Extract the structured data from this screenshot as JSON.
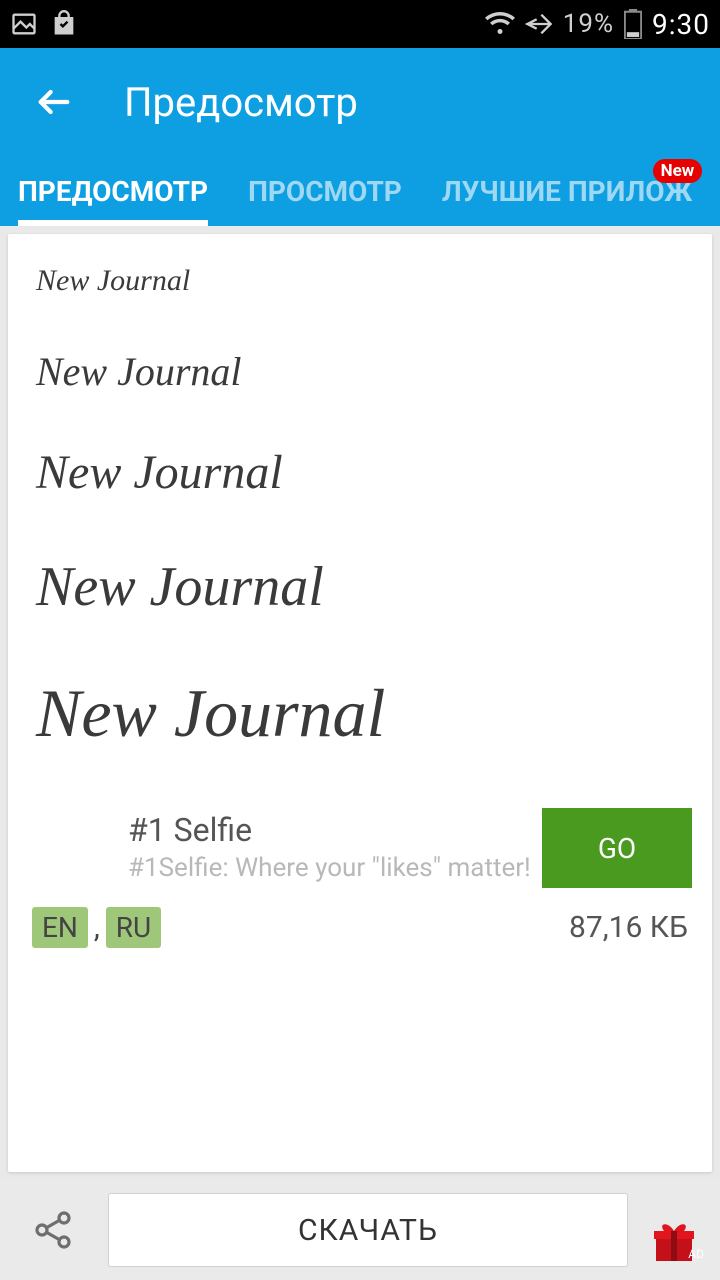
{
  "status": {
    "battery": "19%",
    "time": "9:30"
  },
  "appbar": {
    "title": "Предосмотр"
  },
  "tabs": {
    "t1": "ПРЕДОСМОТР",
    "t2": "ПРОСМОТР",
    "t3": "ЛУЧШИЕ ПРИЛОЖ",
    "new_badge": "New"
  },
  "preview": {
    "sample_text": "New Journal"
  },
  "ad": {
    "title": "#1 Selfie",
    "subtitle": "#1Selfie: Where your \"likes\" matter!",
    "cta": "GO"
  },
  "meta": {
    "lang1": "EN",
    "lang_sep": ",",
    "lang2": "RU",
    "size": "87,16 КБ"
  },
  "bottom": {
    "download": "СКАЧАТЬ",
    "gift_ad": "AD"
  }
}
